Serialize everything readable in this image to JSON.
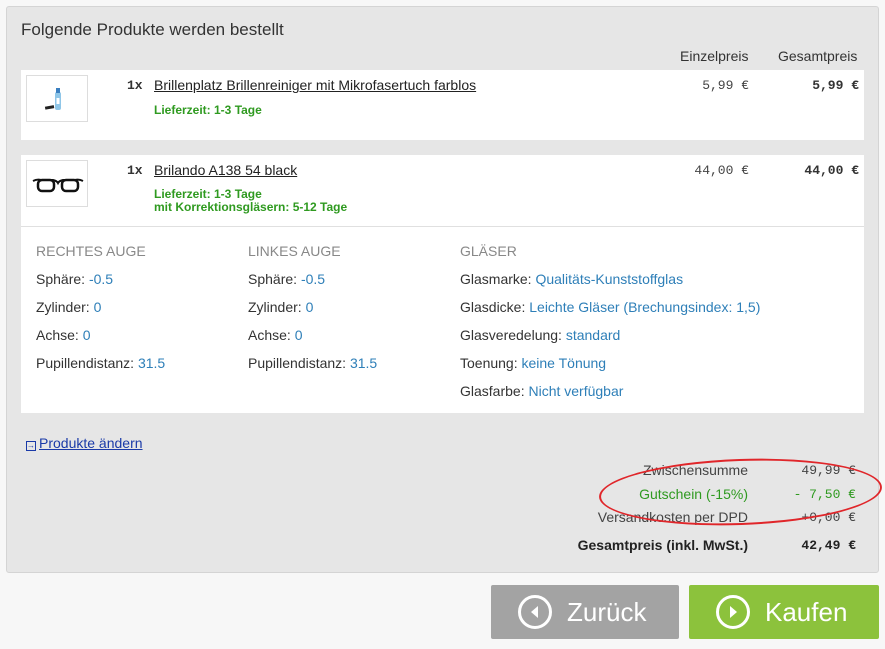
{
  "title": "Folgende Produkte werden bestellt",
  "columns": {
    "unit": "Einzelpreis",
    "total": "Gesamtpreis"
  },
  "items": [
    {
      "qty": "1x",
      "name": "Brillenplatz Brillenreiniger mit Mikrofasertuch farblos",
      "delivery": "Lieferzeit: 1-3 Tage",
      "unit_price": "5,99 €",
      "total_price": "5,99 €",
      "thumbnail": "cleaner-bottle-icon"
    },
    {
      "qty": "1x",
      "name": "Brilando A138 54 black",
      "delivery": "Lieferzeit: 1-3 Tage",
      "delivery2": "mit Korrektionsgläsern: 5-12 Tage",
      "unit_price": "44,00 €",
      "total_price": "44,00 €",
      "thumbnail": "glasses-icon"
    }
  ],
  "prescription": {
    "right": {
      "heading": "RECHTES AUGE",
      "rows": [
        {
          "label": "Sphäre:",
          "value": "-0.5"
        },
        {
          "label": "Zylinder:",
          "value": "0"
        },
        {
          "label": "Achse:",
          "value": "0"
        },
        {
          "label": "Pupillendistanz:",
          "value": "31.5"
        }
      ]
    },
    "left": {
      "heading": "LINKES AUGE",
      "rows": [
        {
          "label": "Sphäre:",
          "value": "-0.5"
        },
        {
          "label": "Zylinder:",
          "value": "0"
        },
        {
          "label": "Achse:",
          "value": "0"
        },
        {
          "label": "Pupillendistanz:",
          "value": "31.5"
        }
      ]
    },
    "lenses": {
      "heading": "GLÄSER",
      "rows": [
        {
          "label": "Glasmarke:",
          "value": "Qualitäts-Kunststoffglas"
        },
        {
          "label": "Glasdicke:",
          "value": "Leichte Gläser (Brechungsindex: 1,5)"
        },
        {
          "label": "Glasveredelung:",
          "value": "standard"
        },
        {
          "label": "Toenung:",
          "value": "keine Tönung"
        },
        {
          "label": "Glasfarbe:",
          "value": "Nicht verfügbar"
        }
      ]
    }
  },
  "change_link": "Produkte ändern",
  "summary": {
    "subtotal_label": "Zwischensumme",
    "subtotal_value": "49,99 €",
    "voucher_label": "Gutschein (-15%)",
    "voucher_value": "- 7,50 €",
    "shipping_label": "Versandkosten per DPD",
    "shipping_value": "+0,00 €",
    "grand_label": "Gesamtpreis (inkl. MwSt.)",
    "grand_value": "42,49 €"
  },
  "buttons": {
    "back": "Zurück",
    "buy": "Kaufen"
  },
  "colors": {
    "buy": "#8cc23c",
    "back": "#a3a3a3",
    "highlight": "#e0262a",
    "link_value": "#2e7fb8",
    "delivery": "#2f9a20"
  }
}
